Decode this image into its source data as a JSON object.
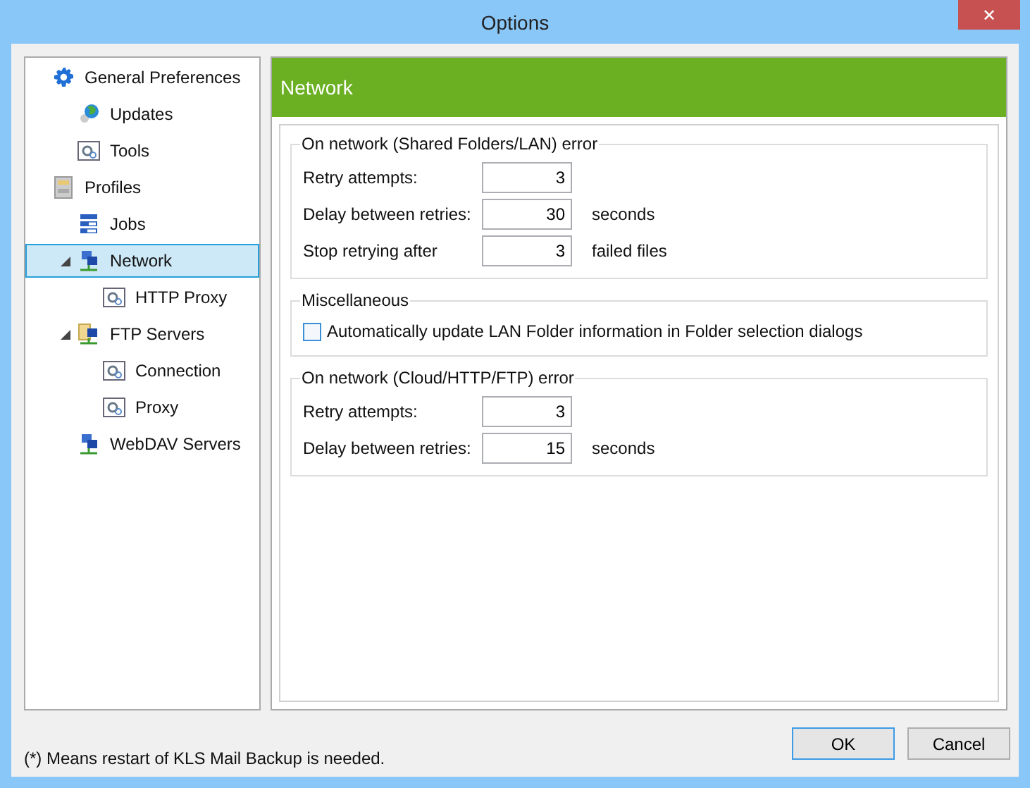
{
  "window": {
    "title": "Options",
    "close": "✕"
  },
  "tree": [
    {
      "label": "General Preferences",
      "kind": "gear",
      "selected": false,
      "children": [
        {
          "label": "Updates",
          "kind": "globe",
          "selected": false
        },
        {
          "label": "Tools",
          "kind": "page",
          "selected": false
        }
      ]
    },
    {
      "label": "Profiles",
      "kind": "cabinet",
      "selected": false,
      "children": [
        {
          "label": "Jobs",
          "kind": "list",
          "selected": false
        },
        {
          "label": "Network",
          "kind": "network",
          "selected": true,
          "expanded": true,
          "children": [
            {
              "label": "HTTP Proxy",
              "kind": "page",
              "selected": false
            }
          ]
        },
        {
          "label": "FTP Servers",
          "kind": "ftp",
          "selected": false,
          "expanded": true,
          "children": [
            {
              "label": "Connection",
              "kind": "page",
              "selected": false
            },
            {
              "label": "Proxy",
              "kind": "page",
              "selected": false
            }
          ]
        },
        {
          "label": "WebDAV Servers",
          "kind": "network",
          "selected": false
        }
      ]
    }
  ],
  "panel": {
    "title": "Network",
    "groups": [
      {
        "title": "On network (Shared Folders/LAN) error",
        "rows": [
          {
            "kind": "field",
            "label": "Retry attempts:",
            "value": "3"
          },
          {
            "kind": "field",
            "label": "Delay between retries:",
            "value": "30",
            "unit": "seconds"
          },
          {
            "kind": "field",
            "label": "Stop retrying after",
            "value": "3",
            "unit": "failed files"
          }
        ]
      },
      {
        "title": "Miscellaneous",
        "rows": [
          {
            "kind": "checkbox",
            "label": "Automatically update LAN Folder information in Folder selection dialogs",
            "checked": false
          }
        ]
      },
      {
        "title": "On network (Cloud/HTTP/FTP) error",
        "rows": [
          {
            "kind": "field",
            "label": "Retry attempts:",
            "value": "3"
          },
          {
            "kind": "field",
            "label": "Delay between retries:",
            "value": "15",
            "unit": "seconds"
          }
        ]
      }
    ]
  },
  "footer": {
    "note": "(*) Means restart of KLS Mail Backup is needed.",
    "buttons": [
      "OK",
      "Cancel"
    ]
  }
}
